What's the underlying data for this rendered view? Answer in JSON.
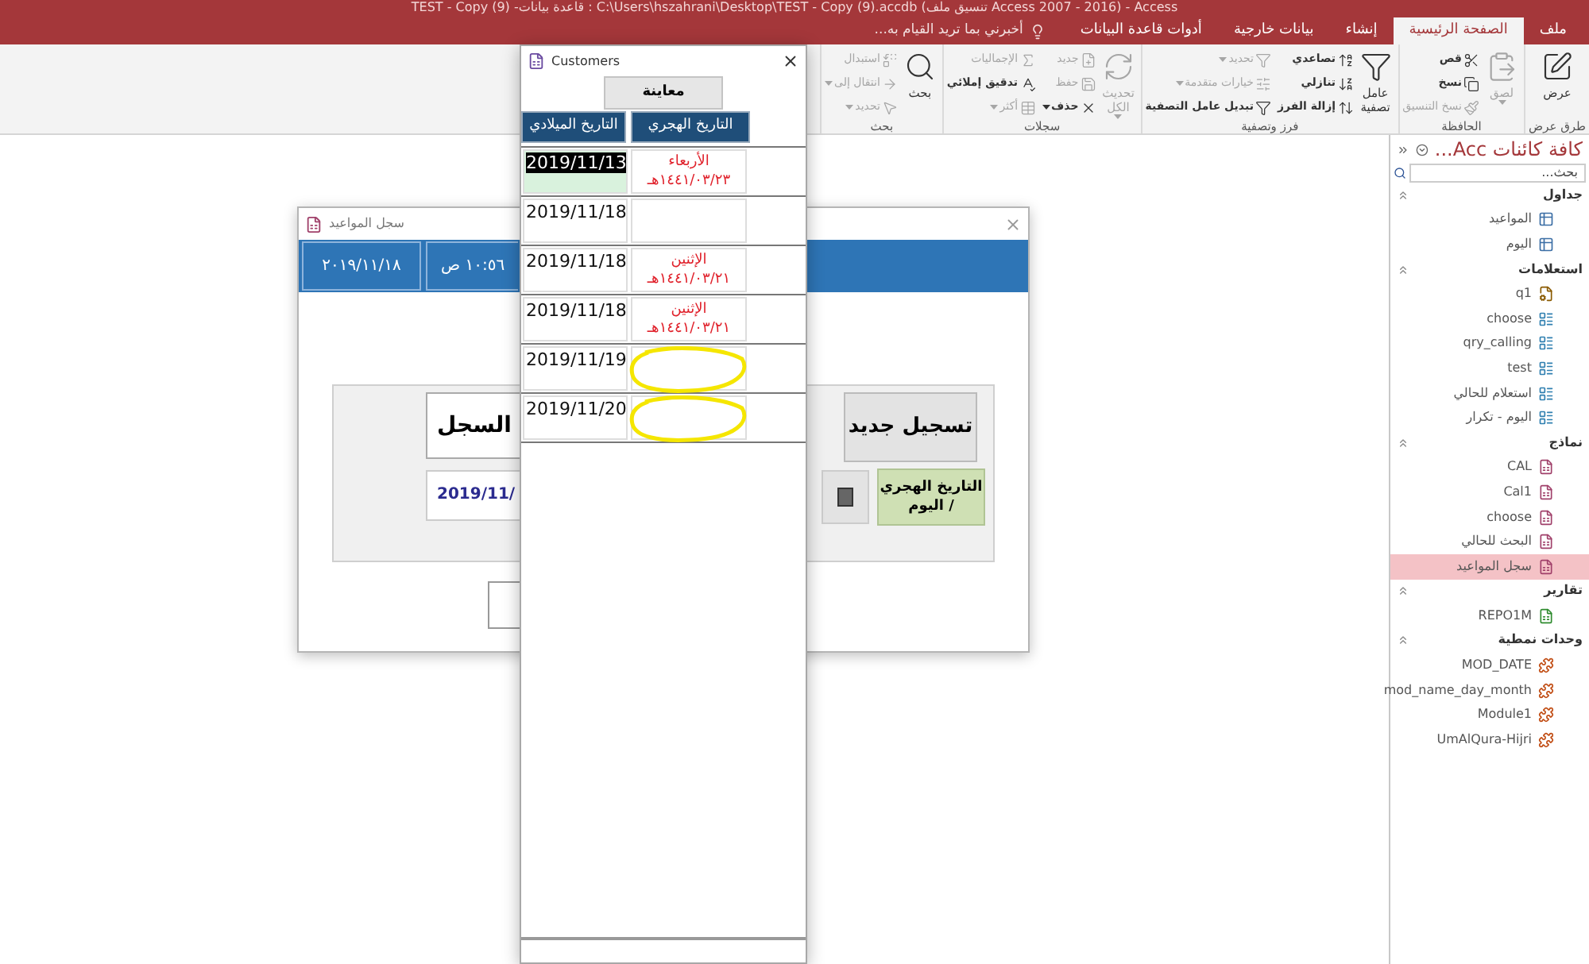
{
  "window": {
    "title": "Access - (Access 2007 - 2016 تنسيق ملف) C:\\Users\\hszahrani\\Desktop\\TEST - Copy (9).accdb : قاعدة بيانات- TEST - Copy (9)"
  },
  "ribbon_tabs": [
    {
      "label": "ملف",
      "selected": false
    },
    {
      "label": "الصفحة الرئيسية",
      "selected": true
    },
    {
      "label": "إنشاء",
      "selected": false
    },
    {
      "label": "بيانات خارجية",
      "selected": false
    },
    {
      "label": "أدوات قاعدة البيانات",
      "selected": false
    }
  ],
  "tell_me": {
    "label": "أخبرني بما تريد القيام به..."
  },
  "ribbon_groups": [
    {
      "label": "طرق عرض",
      "commands": [
        {
          "label": "عرض",
          "kind": "large",
          "disabled": false,
          "dropdown": false
        }
      ]
    },
    {
      "label": "الحافظة",
      "commands": [
        {
          "label": "لصق",
          "kind": "large",
          "disabled": true,
          "dropdown": true
        },
        {
          "label": "قص",
          "kind": "small",
          "disabled": false,
          "dropdown": false
        },
        {
          "label": "نسخ",
          "kind": "small",
          "disabled": false,
          "dropdown": false
        },
        {
          "label": "نسخ التنسيق",
          "kind": "small",
          "disabled": true,
          "dropdown": false
        }
      ]
    },
    {
      "label": "فرز وتصفية",
      "commands": [
        {
          "label": "عامل تصفية",
          "kind": "large",
          "disabled": false,
          "dropdown": false
        },
        {
          "label": "تصاعدي",
          "kind": "small",
          "disabled": false,
          "dropdown": false
        },
        {
          "label": "تنازلي",
          "kind": "small",
          "disabled": false,
          "dropdown": false
        },
        {
          "label": "إزالة الفرز",
          "kind": "small",
          "disabled": false,
          "dropdown": false
        },
        {
          "label": "تحديد",
          "kind": "small",
          "disabled": true,
          "dropdown": true
        },
        {
          "label": "خيارات متقدمة",
          "kind": "small",
          "disabled": true,
          "dropdown": true
        },
        {
          "label": "تبديل عامل التصفية",
          "kind": "small",
          "disabled": false,
          "dropdown": false
        }
      ]
    },
    {
      "label": "سجلات",
      "commands": [
        {
          "label": "تحديث الكل",
          "kind": "large",
          "disabled": true,
          "dropdown": true
        },
        {
          "label": "جديد",
          "kind": "small",
          "disabled": true,
          "dropdown": false
        },
        {
          "label": "حفظ",
          "kind": "small",
          "disabled": true,
          "dropdown": false
        },
        {
          "label": "حذف",
          "kind": "small",
          "disabled": false,
          "dropdown": true
        },
        {
          "label": "الإجماليات",
          "kind": "small",
          "disabled": true,
          "dropdown": false
        },
        {
          "label": "تدقيق إملائي",
          "kind": "small",
          "disabled": false,
          "dropdown": false
        },
        {
          "label": "أكثر",
          "kind": "small",
          "disabled": true,
          "dropdown": true
        }
      ]
    },
    {
      "label": "بحث",
      "commands": [
        {
          "label": "بحث",
          "kind": "large",
          "disabled": false,
          "dropdown": false
        },
        {
          "label": "استبدال",
          "kind": "small",
          "disabled": true,
          "dropdown": false
        },
        {
          "label": "انتقال إلى",
          "kind": "small",
          "disabled": true,
          "dropdown": true
        },
        {
          "label": "تحديد",
          "kind": "small",
          "disabled": true,
          "dropdown": true
        }
      ]
    }
  ],
  "form_window": {
    "title": "سجل المواعيد",
    "header_date": "٢٠١٩/١١/١٨",
    "header_time": "١٠:٥٦ ص",
    "record_button": "السجل",
    "date_field": "2019/11/",
    "new_button": "تسجيل جديد",
    "hijri_button": "التاريخ الهجري / اليوم"
  },
  "customers_window": {
    "title": "Customers",
    "preview_button": "معاينة",
    "columns": [
      "التاريخ الهجري",
      "التاريخ الميلادي"
    ],
    "rows": [
      {
        "gregorian": "2019/11/13",
        "weekday": "الأربعاء",
        "hijri": "١٤٤١/٠٣/٢٣هـ",
        "selected": true,
        "marked": false
      },
      {
        "gregorian": "2019/11/18",
        "selected": false,
        "marked": false
      },
      {
        "gregorian": "2019/11/18",
        "weekday": "الإثنين",
        "hijri": "١٤٤١/٠٣/٢١هـ",
        "selected": false,
        "marked": false
      },
      {
        "gregorian": "2019/11/18",
        "weekday": "الإثنين",
        "hijri": "١٤٤١/٠٣/٢١هـ",
        "selected": false,
        "marked": false
      },
      {
        "gregorian": "2019/11/19",
        "selected": false,
        "marked": true
      },
      {
        "gregorian": "2019/11/20",
        "selected": false,
        "marked": true
      }
    ]
  },
  "nav_pane": {
    "title": "كافة كائنات Acc...",
    "search": {
      "placeholder": "بحث..."
    },
    "groups": [
      {
        "label": "جداول",
        "expanded": true,
        "items": [
          {
            "label": "المواعيد",
            "kind": "table",
            "selected": false
          },
          {
            "label": "اليوم",
            "kind": "table",
            "selected": false
          }
        ]
      },
      {
        "label": "استعلامات",
        "expanded": true,
        "items": [
          {
            "label": "q1",
            "kind": "action_query",
            "selected": false
          },
          {
            "label": "choose",
            "kind": "query",
            "selected": false
          },
          {
            "label": "qry_calling",
            "kind": "query",
            "selected": false
          },
          {
            "label": "test",
            "kind": "query",
            "selected": false
          },
          {
            "label": "استعلام للحالي",
            "kind": "query",
            "selected": false
          },
          {
            "label": "اليوم - تكرار",
            "kind": "query",
            "selected": false
          }
        ]
      },
      {
        "label": "نماذج",
        "expanded": true,
        "items": [
          {
            "label": "CAL",
            "kind": "form",
            "selected": false
          },
          {
            "label": "Cal1",
            "kind": "form",
            "selected": false
          },
          {
            "label": "choose",
            "kind": "form",
            "selected": false
          },
          {
            "label": "البحث للحالي",
            "kind": "form",
            "selected": false
          },
          {
            "label": "سجل المواعيد",
            "kind": "form",
            "selected": true
          }
        ]
      },
      {
        "label": "تقارير",
        "expanded": true,
        "items": [
          {
            "label": "REPO1M",
            "kind": "report",
            "selected": false
          }
        ]
      },
      {
        "label": "وحدات نمطية",
        "expanded": true,
        "items": [
          {
            "label": "MOD_DATE",
            "kind": "module",
            "selected": false
          },
          {
            "label": "mod_name_day_month",
            "kind": "module",
            "selected": false
          },
          {
            "label": "Module1",
            "kind": "module",
            "selected": false
          },
          {
            "label": "UmAlQura-Hijri",
            "kind": "module",
            "selected": false
          }
        ]
      }
    ]
  }
}
